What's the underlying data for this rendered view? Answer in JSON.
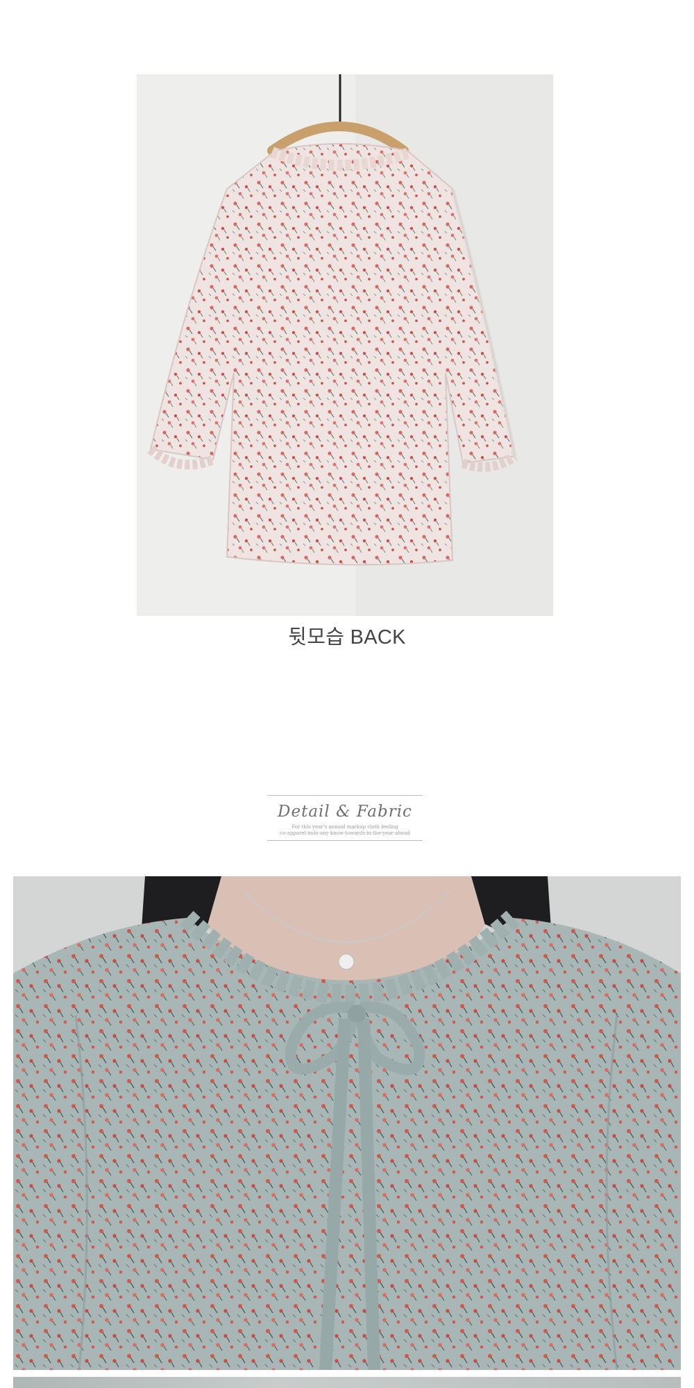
{
  "back_section": {
    "caption": "뒷모습 BACK",
    "photo_alt": "blouse-back-view"
  },
  "detail_heading": {
    "title": "Detail & Fabric",
    "subtitle_line1": "For this year's annual markup cloth feeling",
    "subtitle_line2": "co-apparel-indo-any-know-towards-in-the-year-ahead"
  },
  "detail_section": {
    "photo_alt": "blouse-detail-closeup"
  },
  "colors": {
    "back_fabric": "#efe3df",
    "detail_fabric": "#a9b8b8",
    "flower_red": "#d2584f",
    "leaf_green": "#5d6e68",
    "hanger_wood": "#cfa877"
  }
}
